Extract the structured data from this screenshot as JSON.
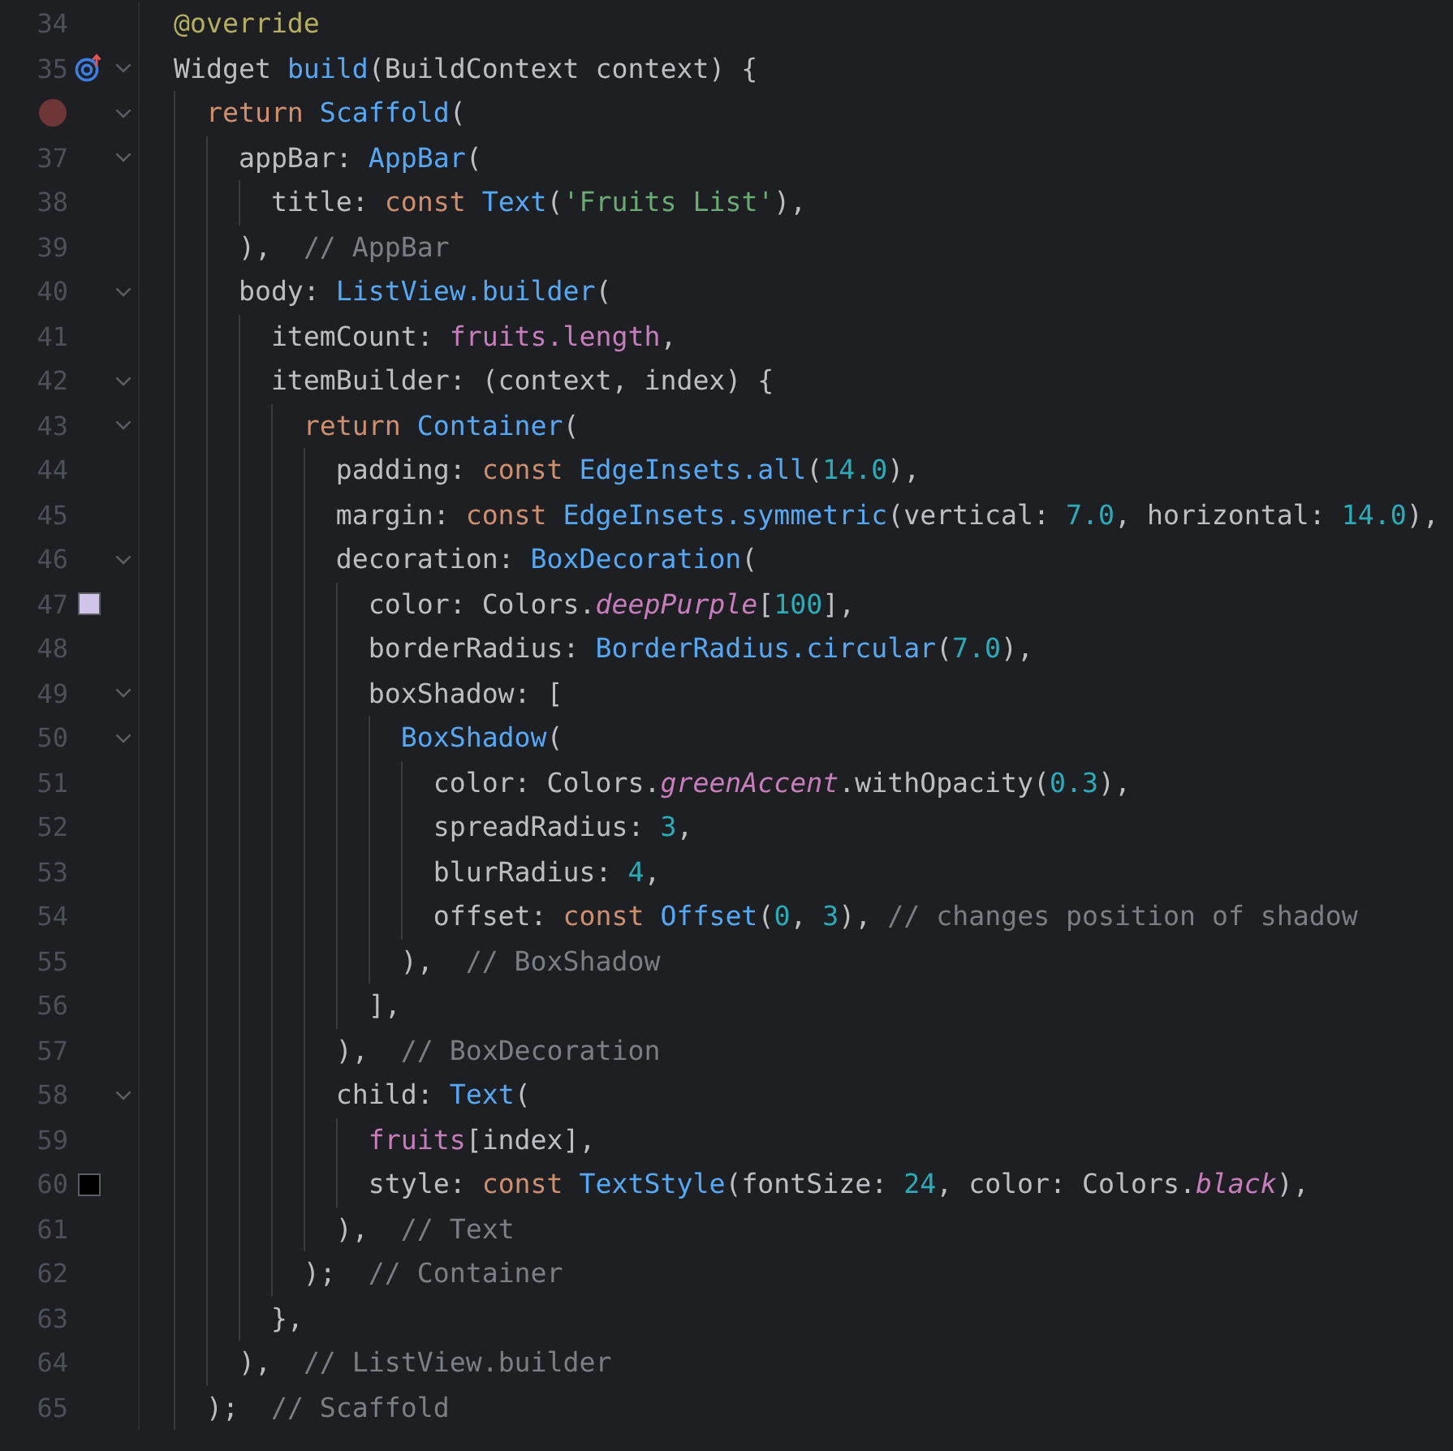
{
  "editor": {
    "lines": [
      {
        "number": "34",
        "fold": false,
        "tokens": [
          {
            "kind": "annotation",
            "text": "@override"
          }
        ]
      },
      {
        "number": "35",
        "fold": true,
        "gutter_icon": {
          "kind": "override"
        },
        "tokens": [
          {
            "kind": "plain",
            "text": "Widget "
          },
          {
            "kind": "function",
            "text": "build"
          },
          {
            "kind": "plain",
            "text": "(BuildContext context) {"
          }
        ]
      },
      {
        "fold": true,
        "gutter_icon": {
          "kind": "breakpoint"
        },
        "tokens": [
          {
            "kind": "keyword",
            "text": "  return "
          },
          {
            "kind": "function",
            "text": "Scaffold"
          },
          {
            "kind": "plain",
            "text": "("
          }
        ]
      },
      {
        "number": "37",
        "fold": true,
        "tokens": [
          {
            "kind": "plain",
            "text": "    appBar: "
          },
          {
            "kind": "function",
            "text": "AppBar"
          },
          {
            "kind": "plain",
            "text": "("
          }
        ]
      },
      {
        "number": "38",
        "fold": false,
        "tokens": [
          {
            "kind": "plain",
            "text": "      title: "
          },
          {
            "kind": "keyword",
            "text": "const "
          },
          {
            "kind": "function",
            "text": "Text"
          },
          {
            "kind": "plain",
            "text": "("
          },
          {
            "kind": "string",
            "text": "'Fruits List'"
          },
          {
            "kind": "plain",
            "text": "),"
          }
        ]
      },
      {
        "number": "39",
        "fold": false,
        "tokens": [
          {
            "kind": "plain",
            "text": "    ),  "
          },
          {
            "kind": "comment",
            "text": "// AppBar"
          }
        ]
      },
      {
        "number": "40",
        "fold": true,
        "tokens": [
          {
            "kind": "plain",
            "text": "    body: "
          },
          {
            "kind": "function",
            "text": "ListView.builder"
          },
          {
            "kind": "plain",
            "text": "("
          }
        ]
      },
      {
        "number": "41",
        "fold": false,
        "tokens": [
          {
            "kind": "plain",
            "text": "      itemCount: "
          },
          {
            "kind": "field",
            "text": "fruits.length"
          },
          {
            "kind": "plain",
            "text": ","
          }
        ]
      },
      {
        "number": "42",
        "fold": true,
        "tokens": [
          {
            "kind": "plain",
            "text": "      itemBuilder: (context, index) {"
          }
        ]
      },
      {
        "number": "43",
        "fold": true,
        "tokens": [
          {
            "kind": "keyword",
            "text": "        return "
          },
          {
            "kind": "function",
            "text": "Container"
          },
          {
            "kind": "plain",
            "text": "("
          }
        ]
      },
      {
        "number": "44",
        "fold": false,
        "tokens": [
          {
            "kind": "plain",
            "text": "          padding: "
          },
          {
            "kind": "keyword",
            "text": "const "
          },
          {
            "kind": "function",
            "text": "EdgeInsets.all"
          },
          {
            "kind": "plain",
            "text": "("
          },
          {
            "kind": "number",
            "text": "14.0"
          },
          {
            "kind": "plain",
            "text": "),"
          }
        ]
      },
      {
        "number": "45",
        "fold": false,
        "tokens": [
          {
            "kind": "plain",
            "text": "          margin: "
          },
          {
            "kind": "keyword",
            "text": "const "
          },
          {
            "kind": "function",
            "text": "EdgeInsets.symmetric"
          },
          {
            "kind": "plain",
            "text": "(vertical: "
          },
          {
            "kind": "number",
            "text": "7.0"
          },
          {
            "kind": "plain",
            "text": ", horizontal: "
          },
          {
            "kind": "number",
            "text": "14.0"
          },
          {
            "kind": "plain",
            "text": "),"
          }
        ]
      },
      {
        "number": "46",
        "fold": true,
        "tokens": [
          {
            "kind": "plain",
            "text": "          decoration: "
          },
          {
            "kind": "function",
            "text": "BoxDecoration"
          },
          {
            "kind": "plain",
            "text": "("
          }
        ]
      },
      {
        "number": "47",
        "fold": false,
        "gutter_icon": {
          "kind": "swatch",
          "color": "#d1c4e9"
        },
        "tokens": [
          {
            "kind": "plain",
            "text": "            color: Colors."
          },
          {
            "kind": "italic",
            "text": "deepPurple"
          },
          {
            "kind": "plain",
            "text": "["
          },
          {
            "kind": "number",
            "text": "100"
          },
          {
            "kind": "plain",
            "text": "],"
          }
        ]
      },
      {
        "number": "48",
        "fold": false,
        "tokens": [
          {
            "kind": "plain",
            "text": "            borderRadius: "
          },
          {
            "kind": "function",
            "text": "BorderRadius.circular"
          },
          {
            "kind": "plain",
            "text": "("
          },
          {
            "kind": "number",
            "text": "7.0"
          },
          {
            "kind": "plain",
            "text": "),"
          }
        ]
      },
      {
        "number": "49",
        "fold": true,
        "tokens": [
          {
            "kind": "plain",
            "text": "            boxShadow: ["
          }
        ]
      },
      {
        "number": "50",
        "fold": true,
        "tokens": [
          {
            "kind": "function",
            "text": "              BoxShadow"
          },
          {
            "kind": "plain",
            "text": "("
          }
        ]
      },
      {
        "number": "51",
        "fold": false,
        "tokens": [
          {
            "kind": "plain",
            "text": "                color: Colors."
          },
          {
            "kind": "italic",
            "text": "greenAccent"
          },
          {
            "kind": "plain",
            "text": ".withOpacity("
          },
          {
            "kind": "number",
            "text": "0.3"
          },
          {
            "kind": "plain",
            "text": "),"
          }
        ]
      },
      {
        "number": "52",
        "fold": false,
        "tokens": [
          {
            "kind": "plain",
            "text": "                spreadRadius: "
          },
          {
            "kind": "number",
            "text": "3"
          },
          {
            "kind": "plain",
            "text": ","
          }
        ]
      },
      {
        "number": "53",
        "fold": false,
        "tokens": [
          {
            "kind": "plain",
            "text": "                blurRadius: "
          },
          {
            "kind": "number",
            "text": "4"
          },
          {
            "kind": "plain",
            "text": ","
          }
        ]
      },
      {
        "number": "54",
        "fold": false,
        "tokens": [
          {
            "kind": "plain",
            "text": "                offset: "
          },
          {
            "kind": "keyword",
            "text": "const "
          },
          {
            "kind": "function",
            "text": "Offset"
          },
          {
            "kind": "plain",
            "text": "("
          },
          {
            "kind": "number",
            "text": "0"
          },
          {
            "kind": "plain",
            "text": ", "
          },
          {
            "kind": "number",
            "text": "3"
          },
          {
            "kind": "plain",
            "text": "), "
          },
          {
            "kind": "comment",
            "text": "// changes position of shadow"
          }
        ]
      },
      {
        "number": "55",
        "fold": false,
        "tokens": [
          {
            "kind": "plain",
            "text": "              ),  "
          },
          {
            "kind": "comment",
            "text": "// BoxShadow"
          }
        ]
      },
      {
        "number": "56",
        "fold": false,
        "tokens": [
          {
            "kind": "plain",
            "text": "            ],"
          }
        ]
      },
      {
        "number": "57",
        "fold": false,
        "tokens": [
          {
            "kind": "plain",
            "text": "          ),  "
          },
          {
            "kind": "comment",
            "text": "// BoxDecoration"
          }
        ]
      },
      {
        "number": "58",
        "fold": true,
        "tokens": [
          {
            "kind": "plain",
            "text": "          child: "
          },
          {
            "kind": "function",
            "text": "Text"
          },
          {
            "kind": "plain",
            "text": "("
          }
        ]
      },
      {
        "number": "59",
        "fold": false,
        "tokens": [
          {
            "kind": "field",
            "text": "            fruits"
          },
          {
            "kind": "plain",
            "text": "[index],"
          }
        ]
      },
      {
        "number": "60",
        "fold": false,
        "gutter_icon": {
          "kind": "swatch",
          "color": "#000000"
        },
        "tokens": [
          {
            "kind": "plain",
            "text": "            style: "
          },
          {
            "kind": "keyword",
            "text": "const "
          },
          {
            "kind": "function",
            "text": "TextStyle"
          },
          {
            "kind": "plain",
            "text": "(fontSize: "
          },
          {
            "kind": "number",
            "text": "24"
          },
          {
            "kind": "plain",
            "text": ", color: Colors."
          },
          {
            "kind": "italic",
            "text": "black"
          },
          {
            "kind": "plain",
            "text": "),"
          }
        ]
      },
      {
        "number": "61",
        "fold": false,
        "tokens": [
          {
            "kind": "plain",
            "text": "          ),  "
          },
          {
            "kind": "comment",
            "text": "// Text"
          }
        ]
      },
      {
        "number": "62",
        "fold": false,
        "tokens": [
          {
            "kind": "plain",
            "text": "        );  "
          },
          {
            "kind": "comment",
            "text": "// Container"
          }
        ]
      },
      {
        "number": "63",
        "fold": false,
        "tokens": [
          {
            "kind": "plain",
            "text": "      },"
          }
        ]
      },
      {
        "number": "64",
        "fold": false,
        "tokens": [
          {
            "kind": "plain",
            "text": "    ),  "
          },
          {
            "kind": "comment",
            "text": "// ListView.builder"
          }
        ]
      },
      {
        "number": "65",
        "fold": false,
        "tokens": [
          {
            "kind": "plain",
            "text": "  );  "
          },
          {
            "kind": "comment",
            "text": "// Scaffold"
          }
        ]
      }
    ]
  }
}
